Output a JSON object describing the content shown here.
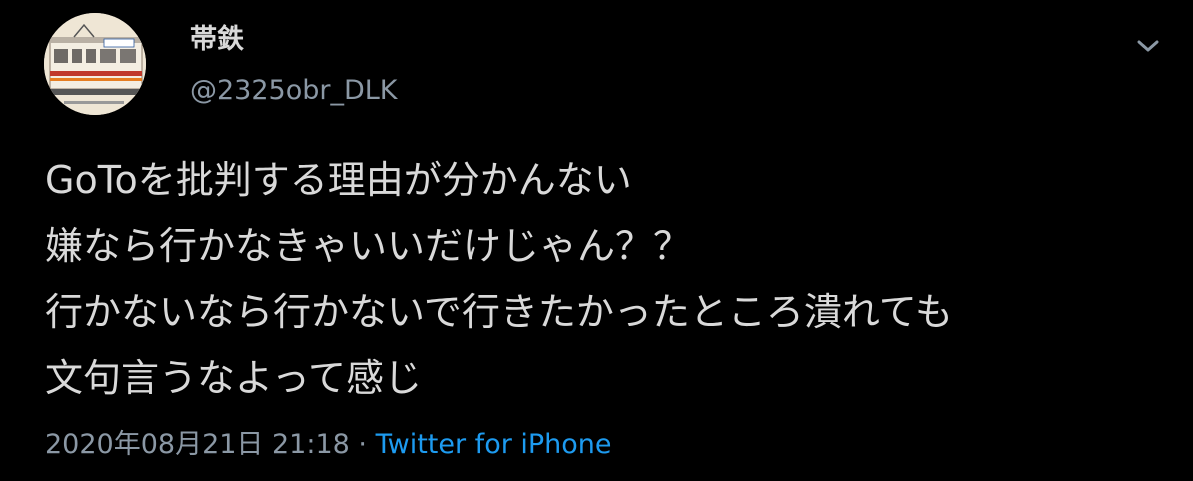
{
  "user": {
    "display_name": "帯鉄",
    "handle": "@2325obr_DLK"
  },
  "tweet": {
    "lines": [
      "GoToを批判する理由が分かんない",
      "嫌なら行かなきゃいいだけじゃん？？",
      "行かないなら行かないで行きたかったところ潰れても",
      "文句言うなよって感じ"
    ]
  },
  "meta": {
    "timestamp": "2020年08月21日 21:18",
    "separator": "·",
    "source": "Twitter for iPhone"
  },
  "icons": {
    "avatar": "train-photo-avatar",
    "menu": "chevron-down-icon"
  },
  "colors": {
    "background": "#000000",
    "text": "#d9d9d9",
    "secondary": "#8b98a5",
    "link": "#1d9bf0"
  }
}
